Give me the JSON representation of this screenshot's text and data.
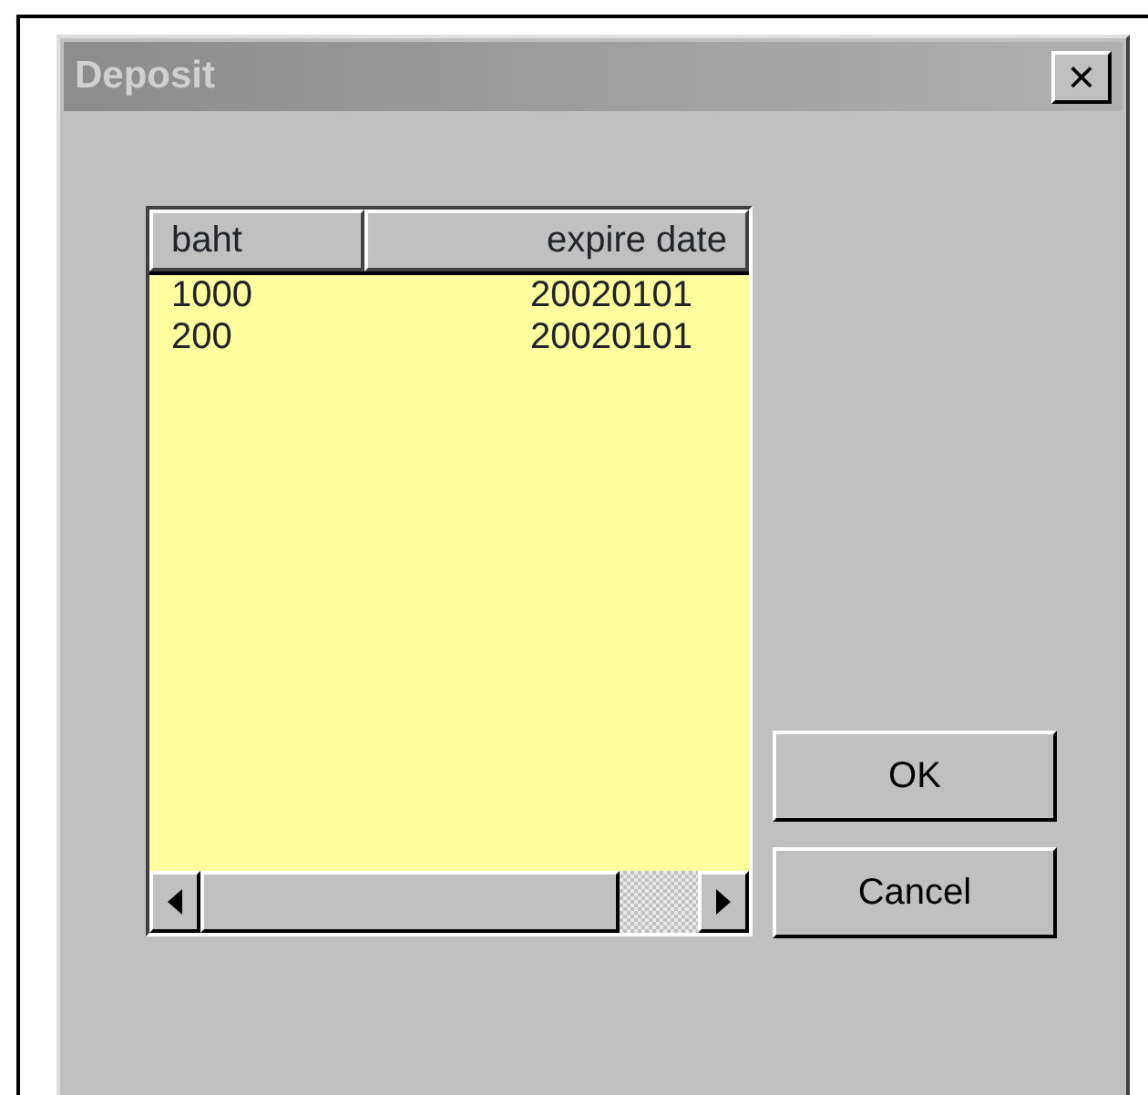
{
  "window": {
    "title": "Deposit",
    "close_label": "×"
  },
  "list": {
    "columns": [
      "baht",
      "expire date"
    ],
    "rows": [
      [
        "1000",
        "20020101"
      ],
      [
        "200",
        "20020101"
      ]
    ]
  },
  "buttons": [
    "OK",
    "Cancel"
  ]
}
